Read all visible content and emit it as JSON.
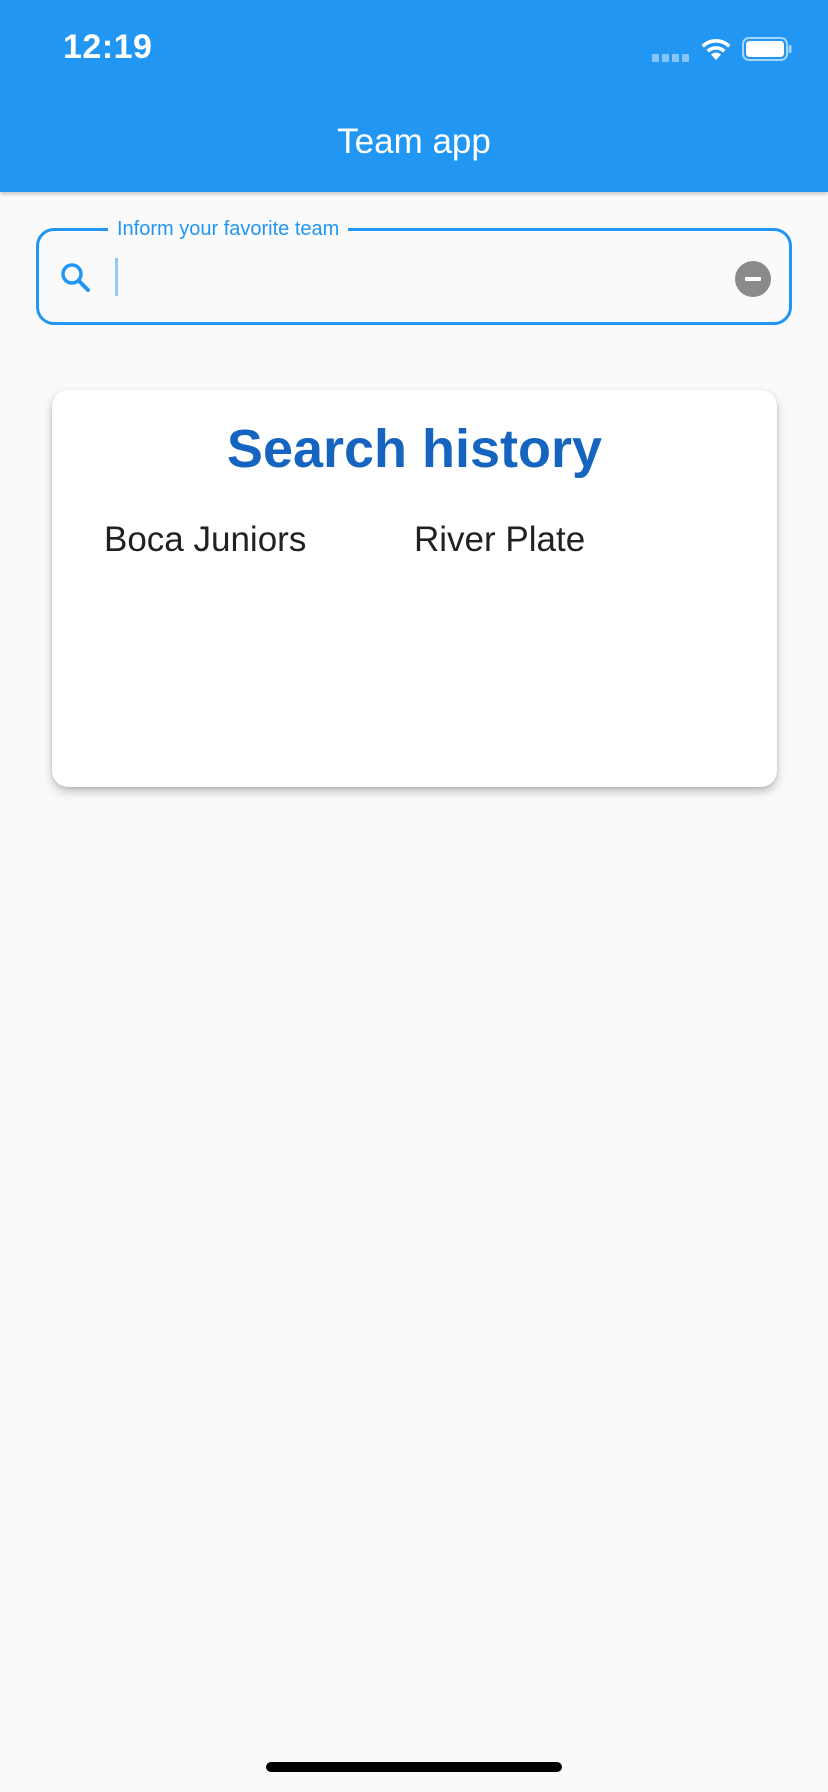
{
  "status_bar": {
    "time": "12:19"
  },
  "app_bar": {
    "title": "Team app"
  },
  "search": {
    "label": "Inform your favorite team",
    "value": "",
    "placeholder": ""
  },
  "history": {
    "title": "Search history",
    "items": [
      "Boca Juniors",
      "River Plate"
    ]
  },
  "colors": {
    "primary": "#2196f3",
    "card_title": "#1565c0",
    "background": "#fafafa"
  },
  "icons": {
    "search": "search-icon",
    "clear": "clear-icon",
    "wifi": "wifi-icon",
    "battery": "battery-icon",
    "signal": "signal-icon"
  }
}
